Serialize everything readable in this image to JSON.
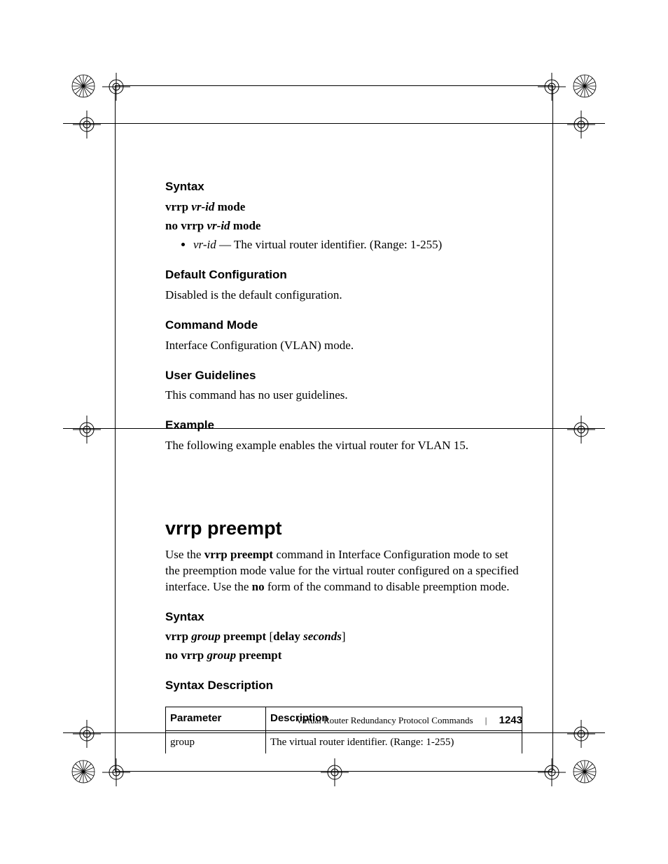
{
  "sections": {
    "syntax1": {
      "heading": "Syntax",
      "line1_a": "vrrp ",
      "line1_b": "vr-id ",
      "line1_c": "mode",
      "line2_a": "no vrrp ",
      "line2_b": "vr-id ",
      "line2_c": " mode",
      "bullet_param": "vr-id ",
      "bullet_rest": "— The virtual router identifier. (Range: 1-255)"
    },
    "default_cfg": {
      "heading": "Default Configuration",
      "body": "Disabled is the default configuration."
    },
    "cmd_mode": {
      "heading": "Command Mode",
      "body": "Interface Configuration (VLAN) mode."
    },
    "user_guidelines": {
      "heading": "User Guidelines",
      "body": "This command has no user guidelines."
    },
    "example": {
      "heading": "Example",
      "body": "The following example enables the virtual router for VLAN 15."
    }
  },
  "command": {
    "title": "vrrp preempt",
    "intro_a": "Use the ",
    "intro_b": "vrrp preempt",
    "intro_c": " command in Interface Configuration mode to set the preemption mode value for the virtual router configured on a specified interface. Use the ",
    "intro_d": "no",
    "intro_e": " form of the command to disable preemption mode."
  },
  "syntax2": {
    "heading": "Syntax",
    "l1_a": "vrrp ",
    "l1_b": "group",
    "l1_c": " preempt ",
    "l1_d": "[",
    "l1_e": "delay ",
    "l1_f": "seconds",
    "l1_g": "]",
    "l2_a": "no vrrp ",
    "l2_b": "group",
    "l2_c": " preempt"
  },
  "syntax_desc": {
    "heading": "Syntax Description",
    "th_param": "Parameter",
    "th_desc": "Description",
    "rows": [
      {
        "param": "group",
        "desc": "The virtual router identifier. (Range: 1-255)"
      }
    ]
  },
  "footer": {
    "title": "Virtual Router Redundancy Protocol Commands",
    "page": "1243"
  }
}
